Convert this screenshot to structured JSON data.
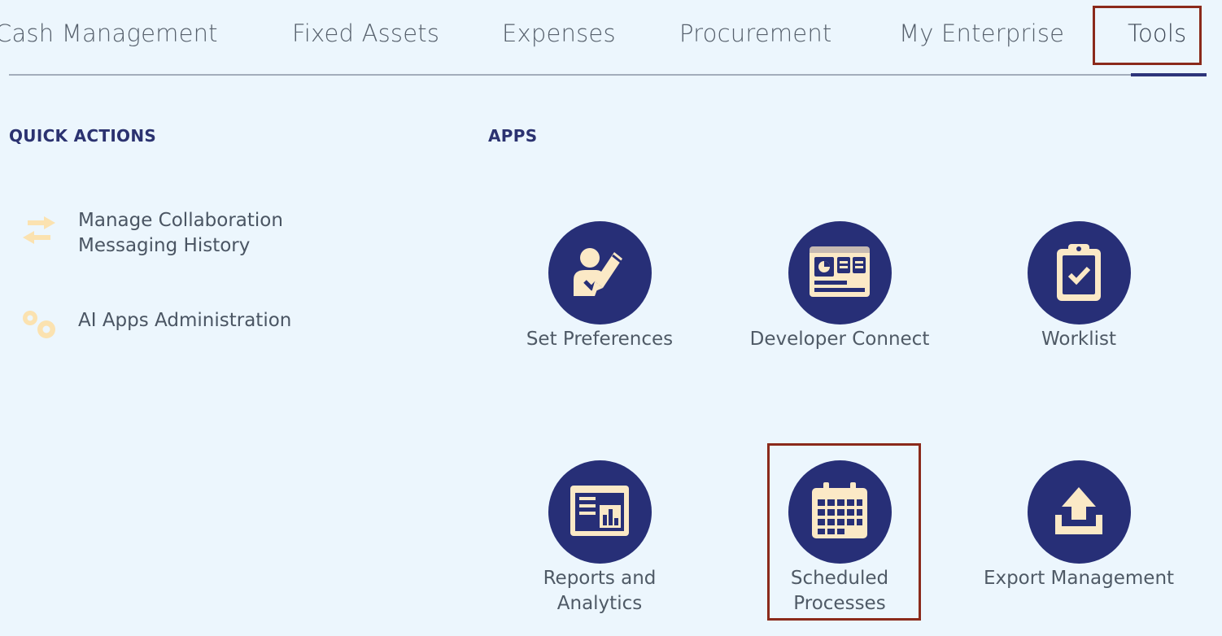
{
  "tabs": [
    {
      "label": "Cash Management"
    },
    {
      "label": "Fixed Assets"
    },
    {
      "label": "Expenses"
    },
    {
      "label": "Procurement"
    },
    {
      "label": "My Enterprise"
    },
    {
      "label": "Tools",
      "active": true
    }
  ],
  "quick_actions": {
    "title": "QUICK ACTIONS",
    "items": [
      {
        "label": "Manage Collaboration Messaging History",
        "icon": "arrows-exchange-icon"
      },
      {
        "label": "AI Apps Administration",
        "icon": "ai-gears-icon"
      }
    ]
  },
  "apps": {
    "title": "APPS",
    "items": [
      {
        "label": "Set Preferences",
        "icon": "user-edit-icon"
      },
      {
        "label": "Developer Connect",
        "icon": "developer-dashboard-icon"
      },
      {
        "label": "Worklist",
        "icon": "clipboard-check-icon"
      },
      {
        "label": "Reports and Analytics",
        "icon": "report-chart-icon"
      },
      {
        "label": "Scheduled Processes",
        "icon": "calendar-icon"
      },
      {
        "label": "Export Management",
        "icon": "upload-icon"
      }
    ]
  },
  "colors": {
    "background": "#ecf6fd",
    "icon_circle": "#272f77",
    "icon_glyph": "#fbe9c6",
    "highlight": "#8b2a1b",
    "heading": "#2b3270"
  }
}
